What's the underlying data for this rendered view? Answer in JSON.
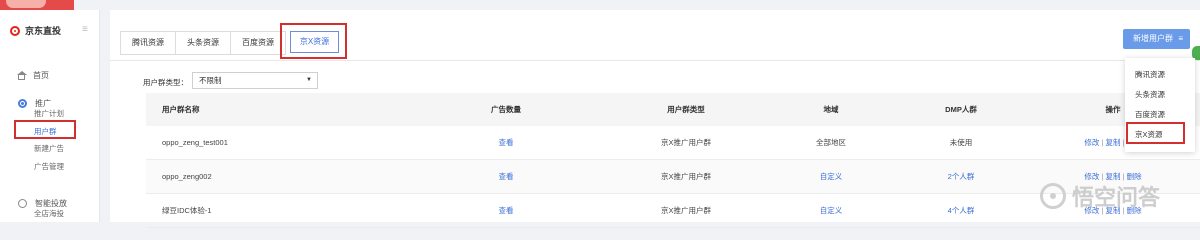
{
  "sidebar": {
    "brand": "京东直投",
    "menu_toggle": "≡",
    "home": "首页",
    "promo_section": "推广",
    "promo_items": [
      "推广计划",
      "用户群",
      "新建广告",
      "广告管理"
    ],
    "smart_section": "智能投放",
    "smart_items": [
      "全店海投"
    ]
  },
  "tabs": [
    "腾讯资源",
    "头条资源",
    "百度资源"
  ],
  "active_tab": "京X资源",
  "new_button": "新增用户群",
  "new_button_icon": "≡",
  "filter": {
    "label": "用户群类型：",
    "value": "不限制",
    "caret": "▼"
  },
  "table": {
    "headers": [
      "用户群名称",
      "广告数量",
      "用户群类型",
      "地域",
      "DMP人群",
      "操作"
    ],
    "rows": [
      {
        "name": "oppo_zeng_test001",
        "ads": "查看",
        "type": "京X推广用户群",
        "region": "全部地区",
        "dmp": "未使用",
        "ops": [
          "修改",
          "复制",
          "删除"
        ]
      },
      {
        "name": "oppo_zeng002",
        "ads": "查看",
        "type": "京X推广用户群",
        "region": "自定义",
        "dmp": "2个人群",
        "ops": [
          "修改",
          "复制",
          "删除"
        ]
      },
      {
        "name": "绿豆IDC体验-1",
        "ads": "查看",
        "type": "京X推广用户群",
        "region": "自定义",
        "dmp": "4个人群",
        "ops": [
          "修改",
          "复制",
          "删除"
        ]
      }
    ],
    "op_separator": "|"
  },
  "dropdown": [
    "腾讯资源",
    "头条资源",
    "百度资源",
    "京X资源"
  ],
  "watermark": "悟空问答",
  "colors": {
    "accent": "#3b6ed8",
    "button": "#6a9be8",
    "highlight": "#d32f2f",
    "brand": "#e2231a"
  }
}
